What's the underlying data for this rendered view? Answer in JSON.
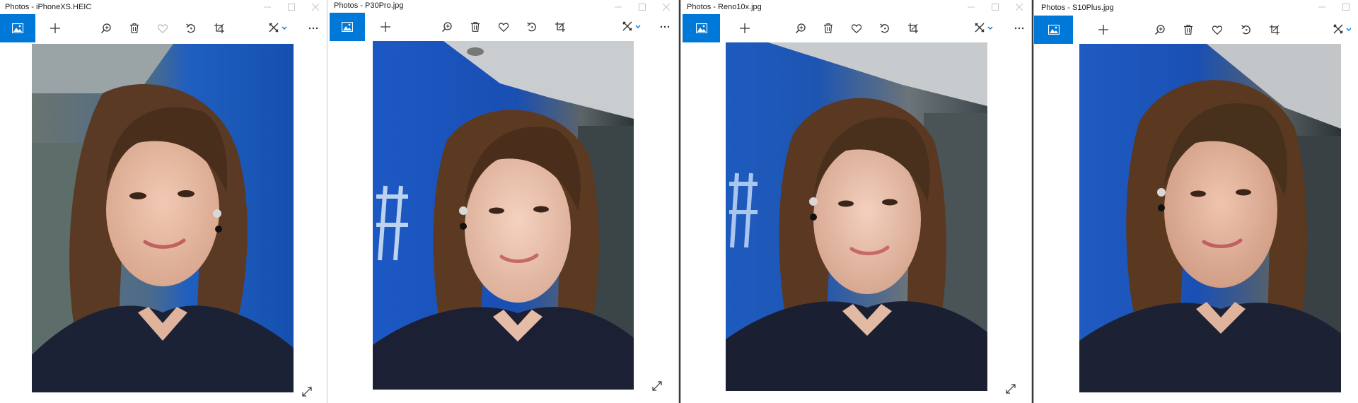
{
  "windows": [
    {
      "title": "Photos - iPhoneXS.HEIC"
    },
    {
      "title": "Photos - P30Pro.jpg"
    },
    {
      "title": "Photos - Reno10x.jpg"
    },
    {
      "title": "Photos - S10Plus.jpg"
    }
  ],
  "toolbar_icons": [
    "view-photos-icon",
    "add-icon",
    "zoom-icon",
    "delete-icon",
    "favorite-icon",
    "rotate-icon",
    "crop-icon",
    "edit-create-icon",
    "more-icon"
  ],
  "colors": {
    "accent": "#0078d7",
    "toolbar_icon": "#333333",
    "window_bg": "#ffffff"
  }
}
